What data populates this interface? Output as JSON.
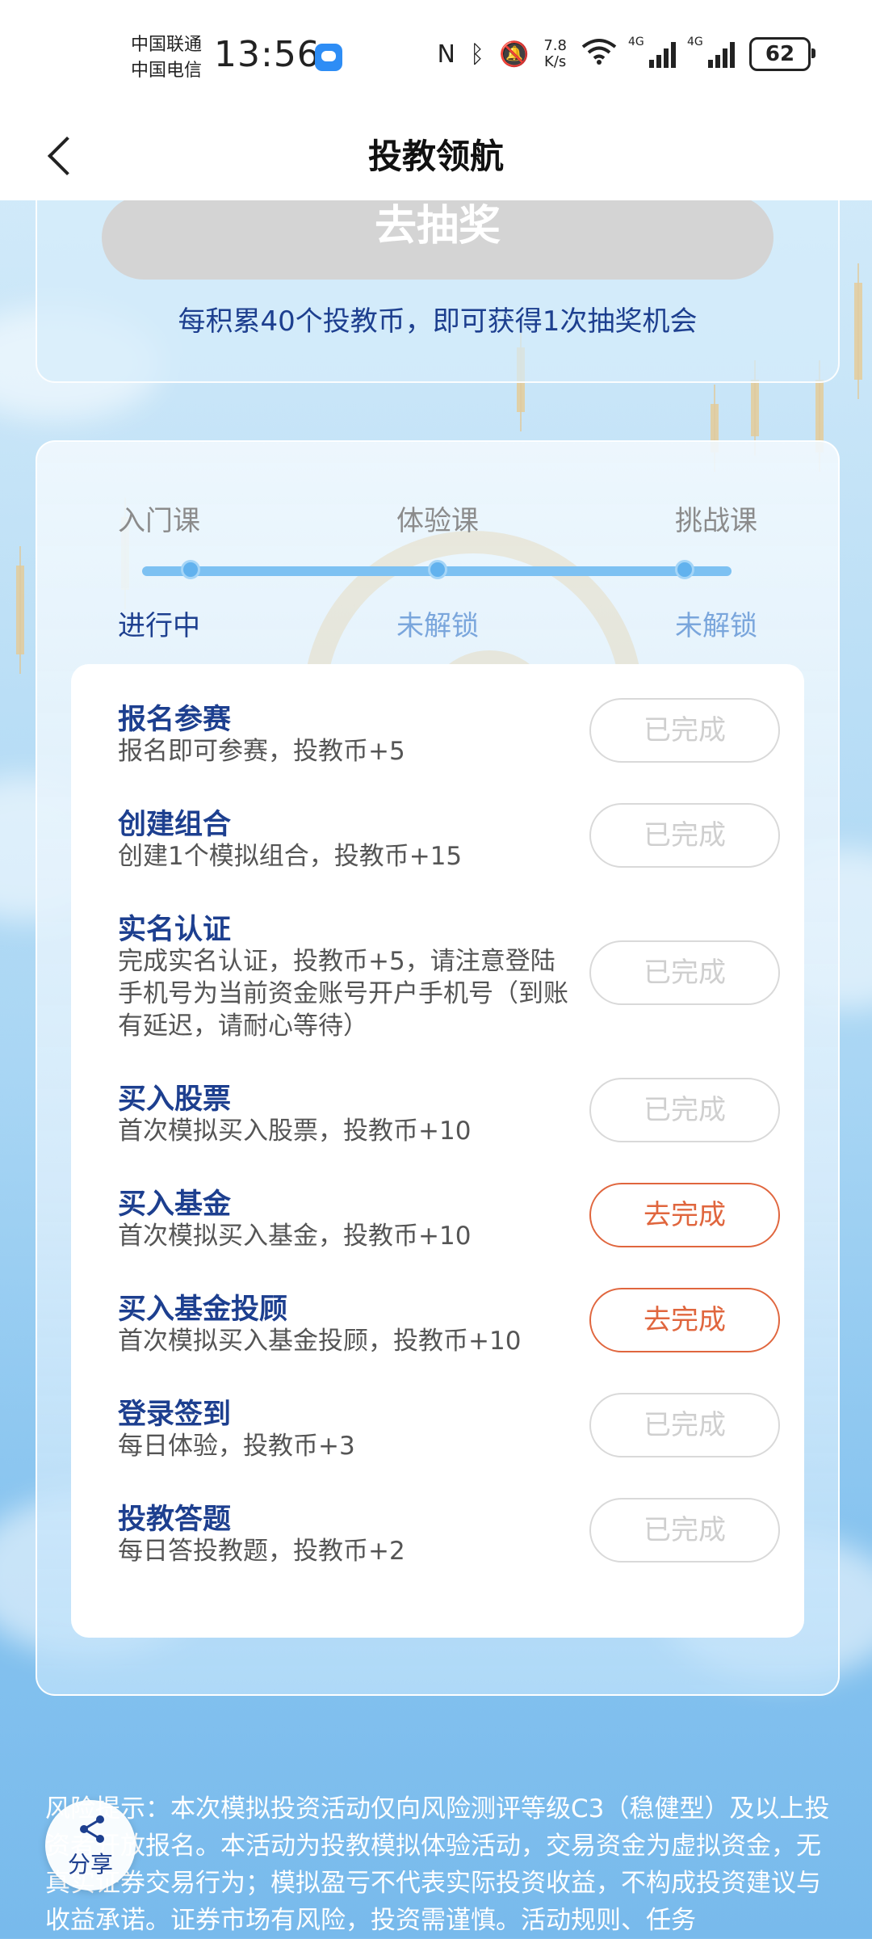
{
  "status_bar": {
    "carrier_1": "中国联通",
    "carrier_2": "中国电信",
    "time": "13:56",
    "net_speed_value": "7.8",
    "net_speed_unit": "K/s",
    "signal_1_label": "4G",
    "signal_2_label": "4G",
    "battery": "62"
  },
  "nav": {
    "title": "投教领航"
  },
  "lottery": {
    "button_label": "去抽奖",
    "note": "每积累40个投教币，即可获得1次抽奖机会"
  },
  "stages": [
    {
      "name": "入门课",
      "status": "进行中"
    },
    {
      "name": "体验课",
      "status": "未解锁"
    },
    {
      "name": "挑战课",
      "status": "未解锁"
    }
  ],
  "tasks": [
    {
      "title": "报名参赛",
      "desc": "报名即可参赛，投教币+5",
      "button": "已完成"
    },
    {
      "title": "创建组合",
      "desc": "创建1个模拟组合，投教币+15",
      "button": "已完成"
    },
    {
      "title": "实名认证",
      "desc": "完成实名认证，投教币+5，请注意登陆手机号为当前资金账号开户手机号（到账有延迟，请耐心等待）",
      "button": "已完成"
    },
    {
      "title": "买入股票",
      "desc": "首次模拟买入股票，投教币+10",
      "button": "已完成"
    },
    {
      "title": "买入基金",
      "desc": "首次模拟买入基金，投教币+10",
      "button": "去完成"
    },
    {
      "title": "买入基金投顾",
      "desc": "首次模拟买入基金投顾，投教币+10",
      "button": "去完成"
    },
    {
      "title": "登录签到",
      "desc": "每日体验，投教币+3",
      "button": "已完成"
    },
    {
      "title": "投教答题",
      "desc": "每日答投教题，投教币+2",
      "button": "已完成"
    }
  ],
  "risk_notice": "风险提示：本次模拟投资活动仅向风险测评等级C3（稳健型）及以上投资者开放报名。本活动为投教模拟体验活动，交易资金为虚拟资金，无真实证券交易行为；模拟盈亏不代表实际投资收益，不构成投资建议与收益承诺。证券市场有风险，投资需谨慎。活动规则、任务",
  "share": {
    "label": "分享"
  },
  "colors": {
    "title_blue": "#1d3f8f",
    "todo_orange": "#e0663e",
    "done_gray": "#cfcfcf",
    "progress_blue": "#7dc1f2"
  }
}
